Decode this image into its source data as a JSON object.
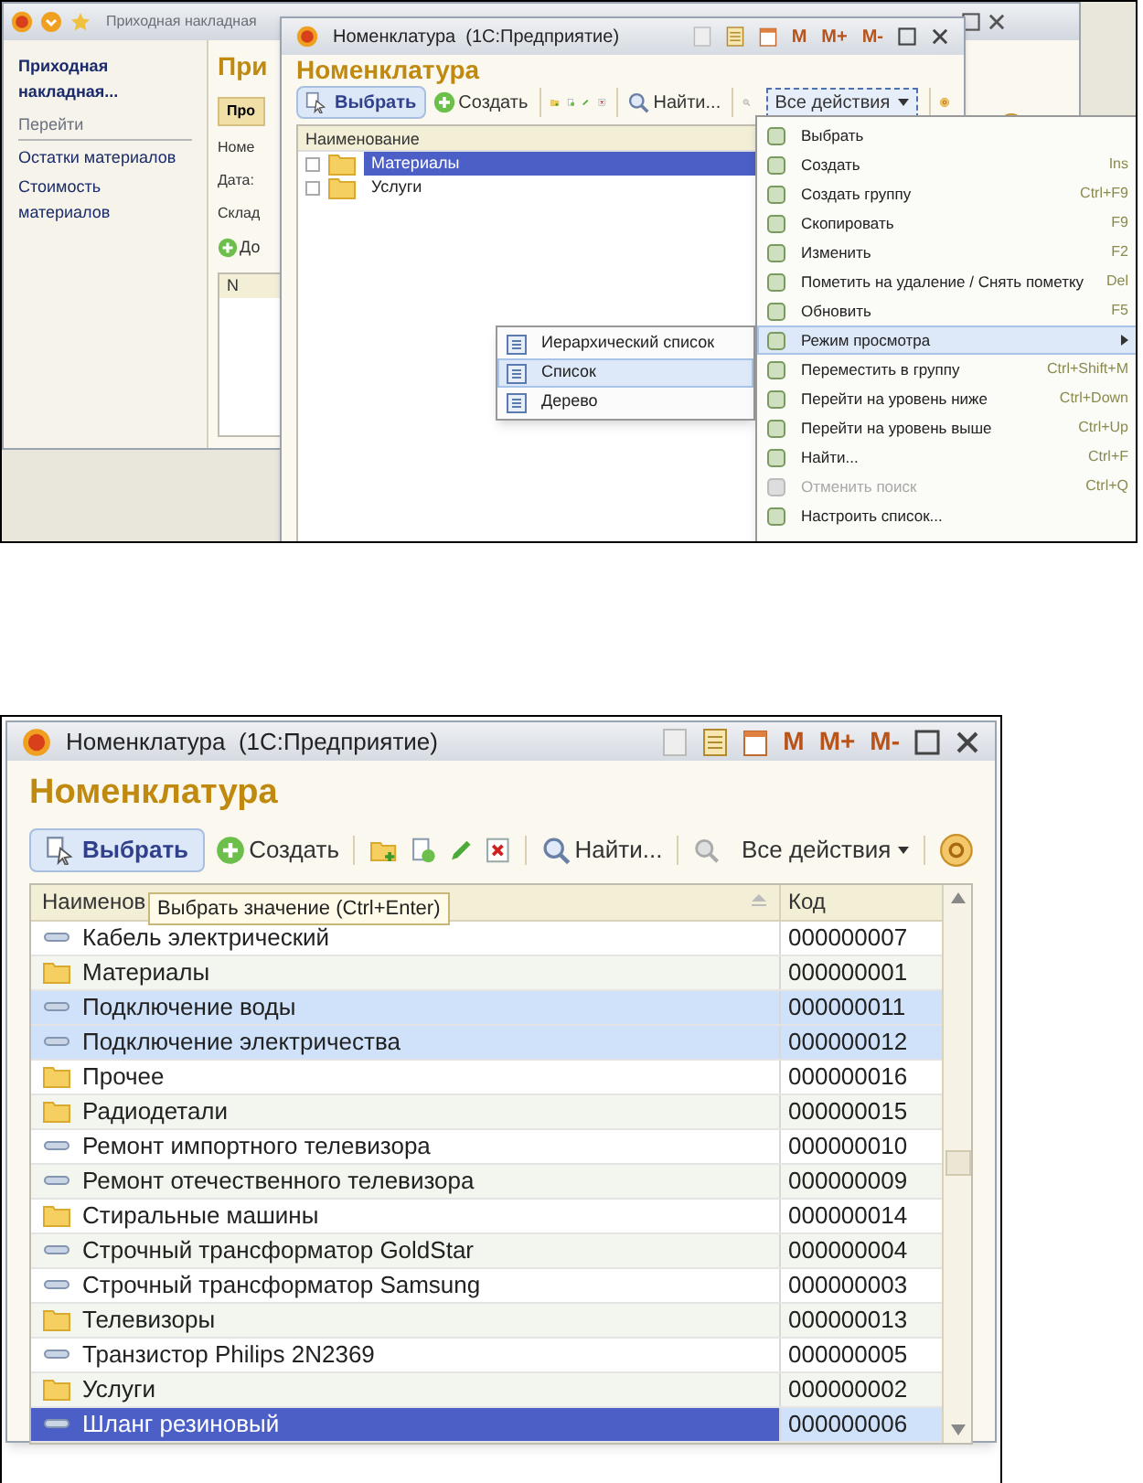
{
  "back_window": {
    "title": "Приходная накладная",
    "sidebar_title": "Приходная накладная...",
    "sidebar_section": "Перейти",
    "links": [
      "Остатки материалов",
      "Стоимость материалов"
    ],
    "heading": "При",
    "post_button": "Про",
    "labels": [
      "Номе",
      "Дата:",
      "Склад"
    ],
    "add_button": "До",
    "column": "N"
  },
  "catalog_window": {
    "title": "Номенклатура  (1С:Предприятие)",
    "memory_buttons": [
      "M",
      "M+",
      "M-"
    ],
    "heading": "Номенклатура",
    "select_button": "Выбрать",
    "create_button": "Создать",
    "find_button": "Найти...",
    "all_actions": "Все действия",
    "column": "Наименование",
    "rows": [
      {
        "name": "Материалы",
        "selected": true
      },
      {
        "name": "Услуги",
        "selected": false
      }
    ]
  },
  "view_submenu": [
    {
      "label": "Иерархический список",
      "selected": false
    },
    {
      "label": "Список",
      "selected": true
    },
    {
      "label": "Дерево",
      "selected": false
    }
  ],
  "actions_menu": [
    {
      "label": "Выбрать",
      "selected": false,
      "disabled": false,
      "submenu": false
    },
    {
      "label": "Создать",
      "shortcut": "Ins",
      "selected": false,
      "disabled": false,
      "submenu": false
    },
    {
      "label": "Создать группу",
      "shortcut": "Ctrl+F9",
      "selected": false,
      "disabled": false,
      "submenu": false
    },
    {
      "label": "Скопировать",
      "shortcut": "F9",
      "selected": false,
      "disabled": false,
      "submenu": false
    },
    {
      "label": "Изменить",
      "shortcut": "F2",
      "selected": false,
      "disabled": false,
      "submenu": false
    },
    {
      "label": "Пометить на удаление / Снять пометку",
      "shortcut": "Del",
      "selected": false,
      "disabled": false,
      "submenu": false
    },
    {
      "label": "Обновить",
      "shortcut": "F5",
      "selected": false,
      "disabled": false,
      "submenu": false
    },
    {
      "label": "Режим просмотра",
      "selected": true,
      "disabled": false,
      "submenu": true
    },
    {
      "label": "Переместить в группу",
      "shortcut": "Ctrl+Shift+M",
      "selected": false,
      "disabled": false,
      "submenu": false
    },
    {
      "label": "Перейти на уровень ниже",
      "shortcut": "Ctrl+Down",
      "selected": false,
      "disabled": false,
      "submenu": false
    },
    {
      "label": "Перейти на уровень выше",
      "shortcut": "Ctrl+Up",
      "selected": false,
      "disabled": false,
      "submenu": false
    },
    {
      "label": "Найти...",
      "shortcut": "Ctrl+F",
      "selected": false,
      "disabled": false,
      "submenu": false
    },
    {
      "label": "Отменить поиск",
      "shortcut": "Ctrl+Q",
      "selected": false,
      "disabled": true,
      "submenu": false
    },
    {
      "label": "Настроить список...",
      "selected": false,
      "disabled": false,
      "submenu": false
    }
  ],
  "list_window": {
    "title": "Номенклатура  (1С:Предприятие)",
    "memory_buttons": [
      "M",
      "M+",
      "M-"
    ],
    "heading": "Номенклатура",
    "select_button": "Выбрать",
    "create_button": "Создать",
    "find_button": "Найти...",
    "all_actions": "Все действия",
    "columns": [
      "Наименов",
      "Код"
    ],
    "tooltip": "Выбрать значение (Ctrl+Enter)",
    "rows": [
      {
        "kind": "item",
        "name": "Кабель электрический",
        "code": "000000007",
        "selected": false,
        "current": false
      },
      {
        "kind": "folder",
        "name": "Материалы",
        "code": "000000001",
        "selected": false,
        "current": false
      },
      {
        "kind": "item",
        "name": "Подключение воды",
        "code": "000000011",
        "selected": true,
        "current": false
      },
      {
        "kind": "item",
        "name": "Подключение электричества",
        "code": "000000012",
        "selected": true,
        "current": false
      },
      {
        "kind": "folder",
        "name": "Прочее",
        "code": "000000016",
        "selected": false,
        "current": false
      },
      {
        "kind": "folder",
        "name": "Радиодетали",
        "code": "000000015",
        "selected": false,
        "current": false
      },
      {
        "kind": "item",
        "name": "Ремонт импортного телевизора",
        "code": "000000010",
        "selected": false,
        "current": false
      },
      {
        "kind": "item",
        "name": "Ремонт отечественного телевизора",
        "code": "000000009",
        "selected": false,
        "current": false
      },
      {
        "kind": "folder",
        "name": "Стиральные машины",
        "code": "000000014",
        "selected": false,
        "current": false
      },
      {
        "kind": "item",
        "name": "Строчный трансформатор GoldStar",
        "code": "000000004",
        "selected": false,
        "current": false
      },
      {
        "kind": "item",
        "name": "Строчный трансформатор Samsung",
        "code": "000000003",
        "selected": false,
        "current": false
      },
      {
        "kind": "folder",
        "name": "Телевизоры",
        "code": "000000013",
        "selected": false,
        "current": false
      },
      {
        "kind": "item",
        "name": "Транзистор Philips 2N2369",
        "code": "000000005",
        "selected": false,
        "current": false
      },
      {
        "kind": "folder",
        "name": "Услуги",
        "code": "000000002",
        "selected": false,
        "current": false
      },
      {
        "kind": "item",
        "name": "Шланг резиновый",
        "code": "000000006",
        "selected": true,
        "current": true
      }
    ]
  }
}
